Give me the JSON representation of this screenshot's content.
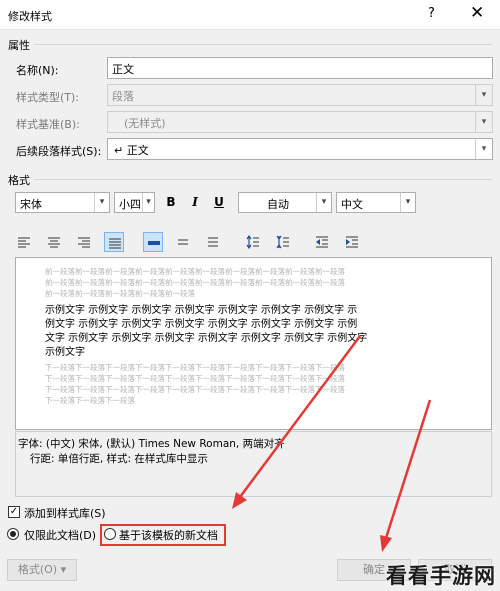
{
  "window": {
    "title": "修改样式",
    "help_glyph": "?",
    "close_glyph": "✕"
  },
  "properties": {
    "heading": "属性",
    "name_label": "名称(N):",
    "name_value": "正文",
    "style_type_label": "样式类型(T):",
    "style_type_value": "段落",
    "based_on_label": "样式基准(B):",
    "based_on_value": "(无样式)",
    "next_style_label": "后续段落样式(S):",
    "next_style_value": "↵ 正文"
  },
  "format": {
    "heading": "格式",
    "font": "宋体",
    "size": "小四",
    "bold": "B",
    "italic": "I",
    "underline": "U",
    "color": "自动",
    "language": "中文"
  },
  "preview": {
    "prev_lines": [
      "前一段落前一段落前一段落前一段落前一段落前一段落前一段落前一段落前一段落前一段落",
      "前一段落前一段落前一段落前一段落前一段落前一段落前一段落前一段落前一段落前一段落",
      "前一段落前一段落前一段落前一段落前一段落"
    ],
    "sample_lines": [
      "示例文字 示例文字 示例文字 示例文字 示例文字 示例文字 示例文字 示",
      "例文字 示例文字 示例文字 示例文字 示例文字 示例文字 示例文字 示例",
      "文字 示例文字 示例文字 示例文字 示例文字 示例文字 示例文字 示例文字",
      "示例文字"
    ],
    "next_lines": [
      "下一段落下一段落下一段落下一段落下一段落下一段落下一段落下一段落下一段落下一段落",
      "下一段落下一段落下一段落下一段落下一段落下一段落下一段落下一段落下一段落下一段落",
      "下一段落下一段落下一段落下一段落下一段落下一段落下一段落下一段落下一段落下一段落",
      "下一段落下一段落下一段落"
    ]
  },
  "description": {
    "line1": "字体: (中文) 宋体, (默认) Times New Roman, 两端对齐",
    "line2": "行距: 单倍行距, 样式: 在样式库中显示"
  },
  "options": {
    "add_to_gallery": "添加到样式库(S)",
    "only_this_doc": "仅限此文档(D)",
    "new_docs_template": "基于该模板的新文档"
  },
  "buttons": {
    "format": "格式(O) ▾",
    "ok": "确定",
    "cancel": "取消"
  },
  "watermark": "看看手游网",
  "accent_colors": {
    "annotation_red": "#e53935",
    "selected_blue": "#cce4f7"
  }
}
